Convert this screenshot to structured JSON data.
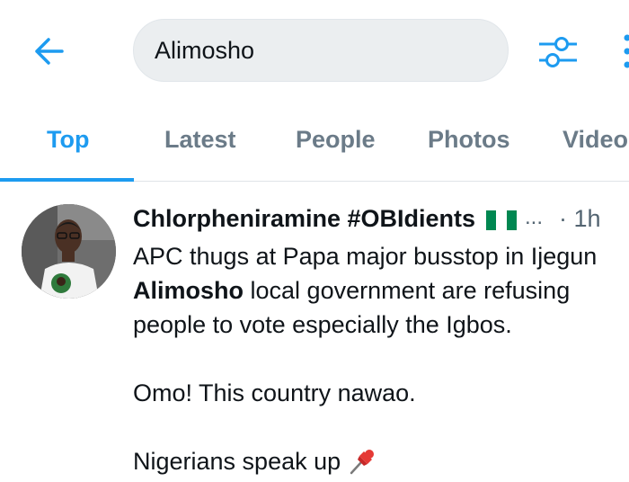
{
  "search": {
    "query": "Alimosho"
  },
  "icons": {
    "back": "arrow-left-icon",
    "filter": "sliders-icon",
    "more": "more-vertical-icon",
    "pin": "pushpin-icon",
    "flag": "nigeria-flag-icon"
  },
  "tabs": [
    {
      "label": "Top",
      "active": true
    },
    {
      "label": "Latest",
      "active": false
    },
    {
      "label": "People",
      "active": false
    },
    {
      "label": "Photos",
      "active": false
    },
    {
      "label": "Videos",
      "active": false
    }
  ],
  "tweet": {
    "author": "Chlorpheniramine #OBIdients",
    "ellipsis": "...",
    "time": "· 1h",
    "lines": {
      "line1": "APC thugs at Papa major busstop in Ijegun",
      "line2_bold": "Alimosho",
      "line2_rest": " local government are refusing",
      "line3": "people to vote especially the Igbos.",
      "line4": "Omo! This country nawao.",
      "line5": "Nigerians speak up "
    }
  },
  "colors": {
    "accent": "#1d9bf0",
    "tab_inactive": "#6b7b88",
    "search_bg": "#ebeef0",
    "text_primary": "#0f1419",
    "text_secondary": "#536471",
    "flag_green": "#008751"
  }
}
